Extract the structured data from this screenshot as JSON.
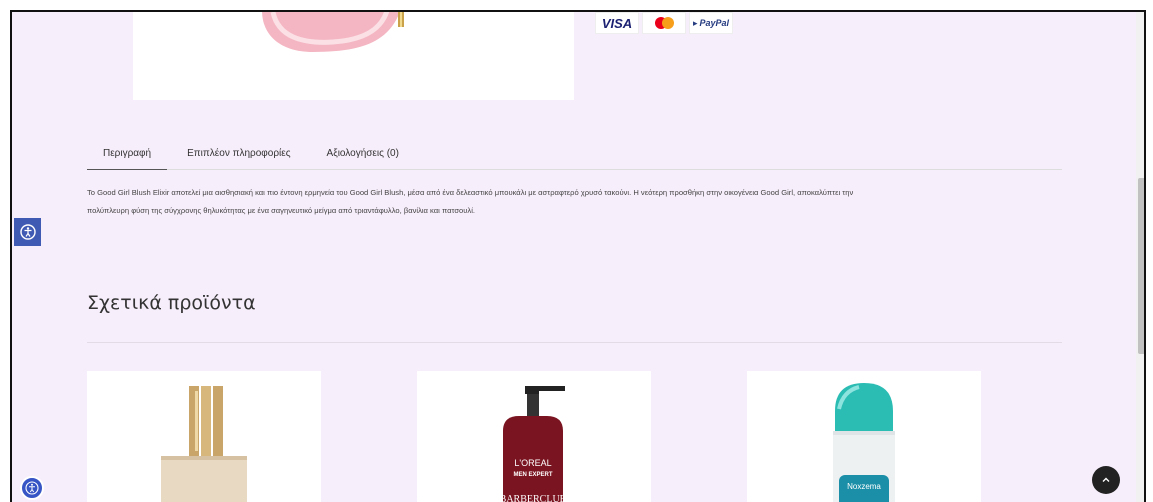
{
  "payments": {
    "visa": "VISA",
    "paypal": "PayPal"
  },
  "tabs": [
    {
      "label": "Περιγραφή"
    },
    {
      "label": "Επιπλέον πληροφορίες"
    },
    {
      "label": "Αξιολογήσεις (0)"
    }
  ],
  "description": {
    "line1": "Το Good Girl Blush Elixir αποτελεί μια αισθησιακή και πιο έντονη ερμηνεία του Good Girl Blush, μέσα από ένα δελεαστικό μπουκάλι με αστραφτερό χρυσό τακούνι. Η νεότερη προσθήκη στην οικογένεια Good Girl, αποκαλύπτει την",
    "line2": "πολύπλευρη φύση της σύγχρονης θηλυκότητας με ένα σαγηνευτικό μείγμα από τριαντάφυλλο, βανίλια και πατσουλί."
  },
  "related": {
    "title": "Σχετικά προϊόντα",
    "products": [
      {
        "label": ""
      },
      {
        "brand": "L'OREAL",
        "sub": "MEN EXPERT",
        "name": "BARBERCLUB"
      },
      {
        "brand": "Noxzema"
      }
    ]
  },
  "colors": {
    "page_bg": "#f7eefb",
    "accent": "#3f5ab3"
  }
}
